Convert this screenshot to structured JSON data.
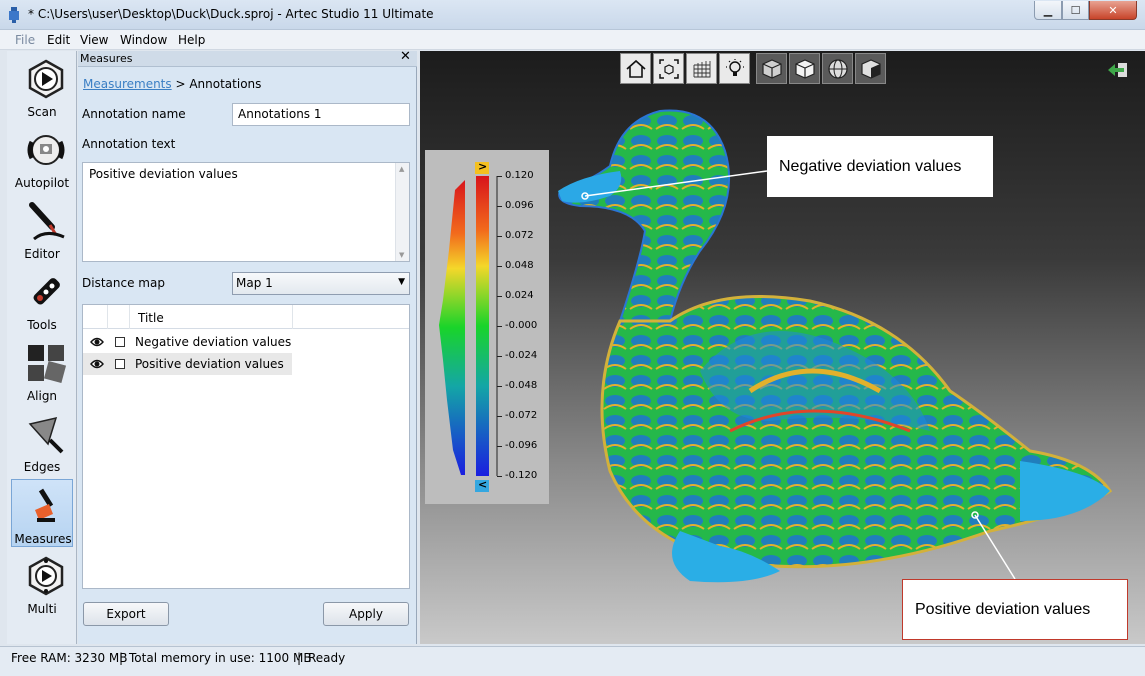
{
  "window": {
    "title": "* C:\\Users\\user\\Desktop\\Duck\\Duck.sproj - Artec Studio 11 Ultimate",
    "controls": {
      "minimize": "▁",
      "maximize": "☐",
      "close": "✕"
    }
  },
  "menu": [
    "File",
    "Edit",
    "View",
    "Window",
    "Help"
  ],
  "toolbar": [
    {
      "label": "Scan",
      "icon": "scan-icon"
    },
    {
      "label": "Autopilot",
      "icon": "autopilot-icon"
    },
    {
      "label": "Editor",
      "icon": "editor-icon"
    },
    {
      "label": "Tools",
      "icon": "tools-icon"
    },
    {
      "label": "Align",
      "icon": "align-icon"
    },
    {
      "label": "Edges",
      "icon": "edges-icon"
    },
    {
      "label": "Measures",
      "icon": "measures-icon",
      "active": true
    },
    {
      "label": "Multi",
      "icon": "multi-icon"
    }
  ],
  "panel": {
    "header": "Measures",
    "close": "✕",
    "breadcrumb_link": "Measurements",
    "breadcrumb_sep": " > ",
    "breadcrumb_current": "Annotations",
    "annotation_name_label": "Annotation name",
    "annotation_name_value": "Annotations 1",
    "annotation_text_label": "Annotation text",
    "annotation_text_value": "Positive deviation values",
    "distance_map_label": "Distance map",
    "distance_map_value": "Map 1",
    "list_header_title": "Title",
    "rows": [
      {
        "title": "Negative deviation values",
        "selected": false
      },
      {
        "title": "Positive deviation values",
        "selected": true
      }
    ],
    "export_label": "Export",
    "apply_label": "Apply"
  },
  "viewport": {
    "view_buttons": [
      "home-view-icon",
      "fit-view-icon",
      "grid-icon",
      "light-icon",
      "solid-cube-icon",
      "shaded-cube-icon",
      "wireframe-sphere-icon",
      "texture-cube-icon"
    ],
    "legend": {
      "top_marker": ">",
      "bottom_marker": "<",
      "ticks": [
        "0.120",
        "0.096",
        "0.072",
        "0.048",
        "0.024",
        "-0.000",
        "-0.024",
        "-0.048",
        "-0.072",
        "-0.096",
        "-0.120"
      ]
    },
    "callouts": {
      "negative": "Negative deviation values",
      "positive": "Positive deviation values"
    }
  },
  "status": {
    "free_ram": "Free RAM: 3230 MB",
    "total_memory": "Total memory in use: 1100 MB",
    "state": "Ready",
    "separator": "|"
  }
}
